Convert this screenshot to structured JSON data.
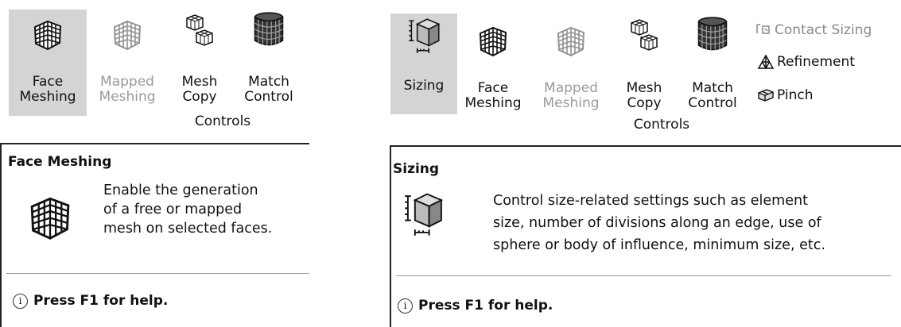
{
  "left": {
    "ribbon": {
      "buttons": [
        {
          "line1": "Face",
          "line2": "Meshing",
          "icon": "face-mesh-icon",
          "state": "selected"
        },
        {
          "line1": "Mapped",
          "line2": "Meshing",
          "icon": "mapped-mesh-icon",
          "state": "disabled"
        },
        {
          "line1": "Mesh",
          "line2": "Copy",
          "icon": "mesh-copy-icon",
          "state": "normal"
        },
        {
          "line1": "Match",
          "line2": "Control",
          "icon": "match-control-icon",
          "state": "normal"
        }
      ],
      "group_label": "Controls"
    },
    "tooltip": {
      "title": "Face Meshing",
      "description": [
        "Enable the generation",
        "of a free or mapped",
        "mesh on selected faces."
      ],
      "help": "Press F1 for help.",
      "icon": "face-mesh-icon"
    }
  },
  "right": {
    "ribbon": {
      "buttons": [
        {
          "line1": "Sizing",
          "line2": "",
          "icon": "sizing-icon",
          "state": "selected"
        },
        {
          "line1": "Face",
          "line2": "Meshing",
          "icon": "face-mesh-icon",
          "state": "normal"
        },
        {
          "line1": "Mapped",
          "line2": "Meshing",
          "icon": "mapped-mesh-icon",
          "state": "disabled"
        },
        {
          "line1": "Mesh",
          "line2": "Copy",
          "icon": "mesh-copy-icon",
          "state": "normal"
        },
        {
          "line1": "Match",
          "line2": "Control",
          "icon": "match-control-icon",
          "state": "normal"
        }
      ],
      "side_items": [
        {
          "label": "Contact Sizing",
          "icon": "contact-sizing-icon",
          "state": "disabled"
        },
        {
          "label": "Refinement",
          "icon": "refinement-icon",
          "state": "normal"
        },
        {
          "label": "Pinch",
          "icon": "pinch-icon",
          "state": "normal"
        }
      ],
      "group_label": "Controls"
    },
    "tooltip": {
      "title": "Sizing",
      "description": [
        "Control size-related settings such as element",
        "size, number of divisions along an edge, use of",
        "sphere or body of influence, minimum size, etc."
      ],
      "help": "Press F1 for help.",
      "icon": "sizing-icon"
    }
  }
}
